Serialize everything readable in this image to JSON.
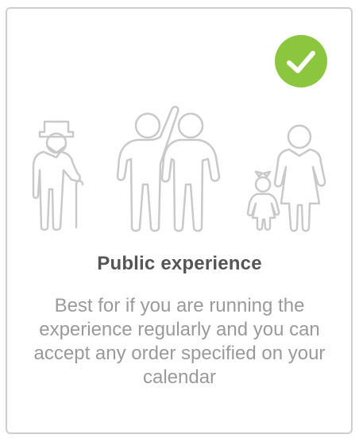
{
  "card": {
    "selected": true,
    "check_icon": "checkmark-icon",
    "accent_color": "#8cc63f",
    "illustration_icons": [
      "elderly-person-icon",
      "two-adults-waving-icon",
      "mother-and-child-icon"
    ],
    "title": "Public experience",
    "description": "Best for if you are running the experience regularly and you can accept any order specified on your calendar"
  }
}
